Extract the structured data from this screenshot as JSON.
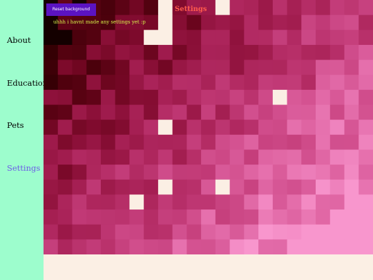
{
  "sidebar": {
    "items": [
      {
        "label": "About",
        "active": false
      },
      {
        "label": "Education",
        "active": false
      },
      {
        "label": "Pets",
        "active": false
      },
      {
        "label": "Settings",
        "active": true
      }
    ]
  },
  "toolbar": {
    "reset_label": "Reset background"
  },
  "main": {
    "title": "Settings",
    "note": "uhhh i havnt made any settings yet :p"
  },
  "colors": {
    "sidebar_bg": "#9dfdcd",
    "active_link": "#6c5ce7",
    "button_bg": "#5b13c1",
    "title_color": "#ff5b4d",
    "note_color": "#d6f24a",
    "page_bg": "#fbefe4"
  }
}
